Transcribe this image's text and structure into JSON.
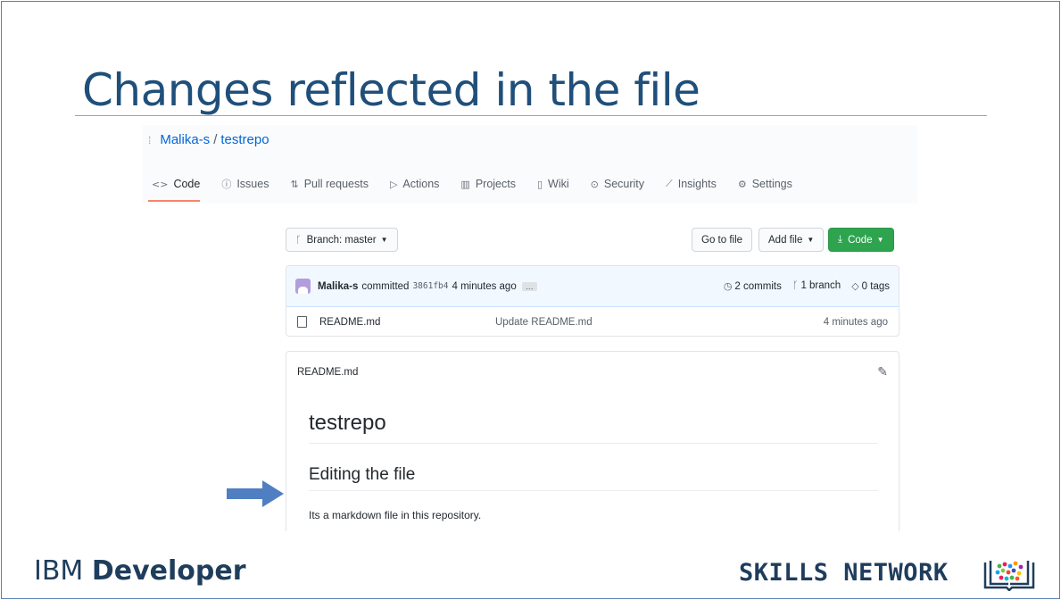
{
  "slide": {
    "title": "Changes reflected in the file",
    "footer_left_light": "IBM ",
    "footer_left_bold": "Developer",
    "footer_right": "SKILLS NETWORK"
  },
  "repo": {
    "owner": "Malika-s",
    "separator": "/",
    "name": "testrepo"
  },
  "nav": [
    {
      "label": "Code",
      "icon": "code-icon",
      "glyph": "<>"
    },
    {
      "label": "Issues",
      "icon": "issue-icon",
      "glyph": "ⓘ"
    },
    {
      "label": "Pull requests",
      "icon": "pull-request-icon",
      "glyph": "⇅"
    },
    {
      "label": "Actions",
      "icon": "play-icon",
      "glyph": "▷"
    },
    {
      "label": "Projects",
      "icon": "project-icon",
      "glyph": "▥"
    },
    {
      "label": "Wiki",
      "icon": "book-icon",
      "glyph": "▯"
    },
    {
      "label": "Security",
      "icon": "shield-icon",
      "glyph": "⊙"
    },
    {
      "label": "Insights",
      "icon": "graph-icon",
      "glyph": "⟋"
    },
    {
      "label": "Settings",
      "icon": "gear-icon",
      "glyph": "⚙"
    }
  ],
  "toolbar": {
    "branch_label": "Branch: master",
    "goto_file": "Go to file",
    "add_file": "Add file",
    "code": "Code"
  },
  "commit": {
    "author": "Malika-s",
    "action": "committed",
    "hash": "3861fb4",
    "time": "4 minutes ago",
    "more": "…",
    "commits": "2 commits",
    "branches": "1 branch",
    "tags": "0 tags"
  },
  "files": [
    {
      "name": "README.md",
      "message": "Update README.md",
      "time": "4 minutes ago"
    }
  ],
  "readme": {
    "filename": "README.md",
    "h1": "testrepo",
    "h2": "Editing the file",
    "paragraph": "Its a markdown file in this repository."
  },
  "colors": {
    "title": "#1f4f7a",
    "link": "#0366d6",
    "green_button": "#2ea44f",
    "arrow": "#4f7fc2"
  }
}
